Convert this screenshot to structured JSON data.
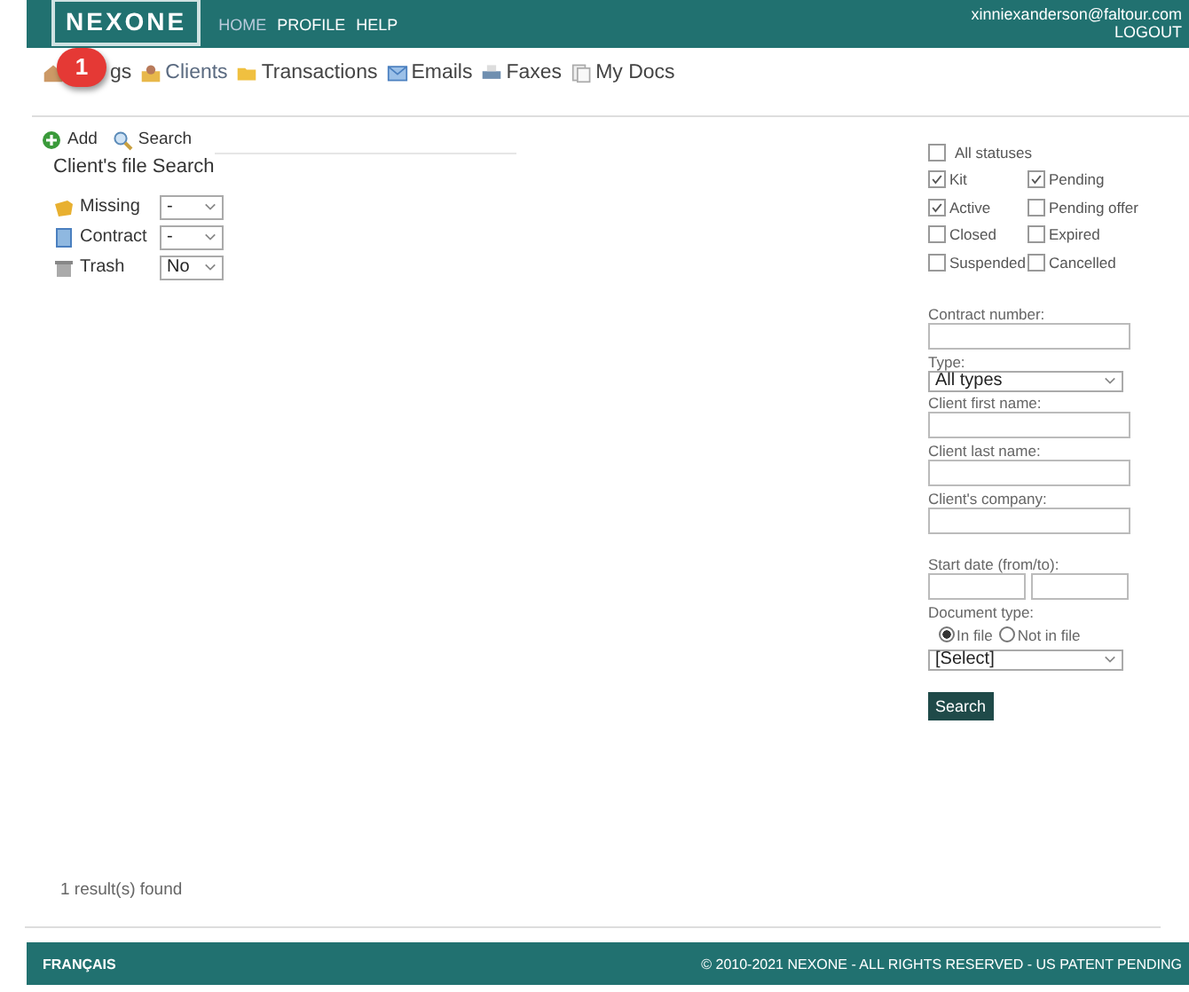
{
  "header": {
    "logo": "NEXONE",
    "menu": [
      "HOME",
      "PROFILE",
      "HELP"
    ],
    "email": "xinniexanderson@faltour.com",
    "logout": "LOGOUT"
  },
  "callout": {
    "number": "1"
  },
  "nav": [
    {
      "label": "gs",
      "kind": "house"
    },
    {
      "label": "Clients",
      "kind": "clients"
    },
    {
      "label": "Transactions",
      "kind": "folder"
    },
    {
      "label": "Emails",
      "kind": "mail"
    },
    {
      "label": "Faxes",
      "kind": "printer"
    },
    {
      "label": "My Docs",
      "kind": "docs"
    }
  ],
  "toolbar": [
    {
      "label": "Add",
      "kind": "add"
    },
    {
      "label": "Search",
      "kind": "search"
    }
  ],
  "file_search": {
    "title": "Client's file Search",
    "filters": [
      {
        "label": "Missing",
        "kind": "missing",
        "value": "-"
      },
      {
        "label": "Contract",
        "kind": "contract",
        "value": "-"
      },
      {
        "label": "Trash",
        "kind": "trash",
        "value": "No"
      }
    ]
  },
  "statuses": {
    "all": {
      "label": "All statuses",
      "checked": false
    },
    "items": [
      {
        "label": "Kit",
        "checked": true
      },
      {
        "label": "Pending",
        "checked": true
      },
      {
        "label": "Active",
        "checked": true
      },
      {
        "label": "Pending offer",
        "checked": false
      },
      {
        "label": "Closed",
        "checked": false
      },
      {
        "label": "Expired",
        "checked": false
      },
      {
        "label": "Suspended",
        "checked": false
      },
      {
        "label": "Cancelled",
        "checked": false
      }
    ]
  },
  "form": {
    "contract_number": "Contract number:",
    "type_label": "Type:",
    "type_value": "All types",
    "first_name": "Client first name:",
    "last_name": "Client last name:",
    "company": "Client's company:",
    "start_date": "Start date (from/to):",
    "document_type": "Document type:",
    "radios": [
      {
        "label": "In file",
        "selected": true
      },
      {
        "label": "Not in file",
        "selected": false
      }
    ],
    "document_value": "[Select]",
    "search_button": "Search"
  },
  "results": "1 result(s) found",
  "footer": {
    "language": "FRANÇAIS",
    "copyright": "© 2010-2021 NEXONE - ALL RIGHTS RESERVED - US PATENT PENDING"
  }
}
